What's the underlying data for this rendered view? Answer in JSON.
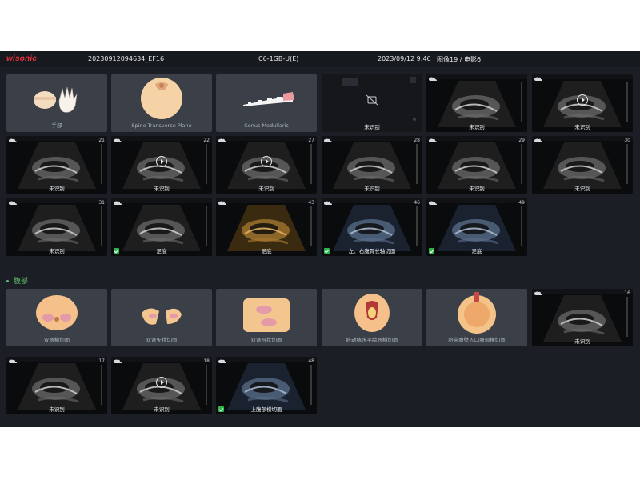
{
  "header": {
    "logo": "wisonic",
    "exam_id": "20230912094634_EF16",
    "probe": "C6-1GB-U(E)",
    "datetime": "2023/09/12 9:46",
    "counts": "图像19 / 电影6"
  },
  "tiles_top": [
    {
      "id": "t1",
      "kind": "diagram",
      "art": "hands",
      "label": "手部"
    },
    {
      "id": "t2",
      "kind": "diagram",
      "art": "spine",
      "label": "Spine Transverse Plane"
    },
    {
      "id": "t3",
      "kind": "diagram",
      "art": "conus",
      "label": "Conus Medullaris"
    },
    {
      "id": "t4",
      "kind": "dark",
      "label": "未识别"
    },
    {
      "id": "t5",
      "kind": "us",
      "label": "未识别",
      "num": ""
    },
    {
      "id": "t6",
      "kind": "us",
      "label": "未识别",
      "play": true
    },
    {
      "id": "t7",
      "kind": "us",
      "label": "未识别",
      "num": "21"
    },
    {
      "id": "t8",
      "kind": "us",
      "label": "未识别",
      "num": "22",
      "play": true
    },
    {
      "id": "t9",
      "kind": "us",
      "label": "未识别",
      "num": "27",
      "play": true
    },
    {
      "id": "t10",
      "kind": "us",
      "label": "未识别",
      "num": "28"
    },
    {
      "id": "t11",
      "kind": "us",
      "label": "未识别",
      "num": "29"
    },
    {
      "id": "t12",
      "kind": "us",
      "label": "未识别",
      "num": "30"
    },
    {
      "id": "t13",
      "kind": "us",
      "label": "未识别",
      "num": "31"
    },
    {
      "id": "t14",
      "kind": "us",
      "label": "足底",
      "num": "",
      "check": true
    },
    {
      "id": "t15",
      "kind": "us",
      "tint": "gold",
      "label": "足底",
      "num": "43"
    },
    {
      "id": "t16",
      "kind": "us",
      "tint": "blue",
      "label": "左、右腹骨长轴切面",
      "num": "46",
      "check": true
    },
    {
      "id": "t17",
      "kind": "us",
      "tint": "blue",
      "label": "足底",
      "num": "49",
      "check": true
    }
  ],
  "section_abdomen": "腹部",
  "tiles_abdomen": [
    {
      "id": "a1",
      "kind": "diagram",
      "art": "kidneys",
      "label": "双肾横切面"
    },
    {
      "id": "a2",
      "kind": "diagram",
      "art": "sagittal",
      "label": "双肾矢状切面"
    },
    {
      "id": "a3",
      "kind": "diagram",
      "art": "coronal",
      "label": "双肾冠状切面"
    },
    {
      "id": "a4",
      "kind": "diagram",
      "art": "bladder",
      "label": "脐动脉水平膀胱横切面"
    },
    {
      "id": "a5",
      "kind": "diagram",
      "art": "cord",
      "label": "脐带腹壁入口腹部横切面"
    },
    {
      "id": "a6",
      "kind": "us",
      "label": "未识别",
      "num": "16"
    },
    {
      "id": "a7",
      "kind": "us",
      "label": "未识别",
      "num": "17"
    },
    {
      "id": "a8",
      "kind": "us",
      "label": "未识别",
      "num": "18",
      "play": true
    },
    {
      "id": "a9",
      "kind": "us",
      "tint": "blue",
      "label": "上腹部横切面",
      "num": "48",
      "check": true
    }
  ]
}
